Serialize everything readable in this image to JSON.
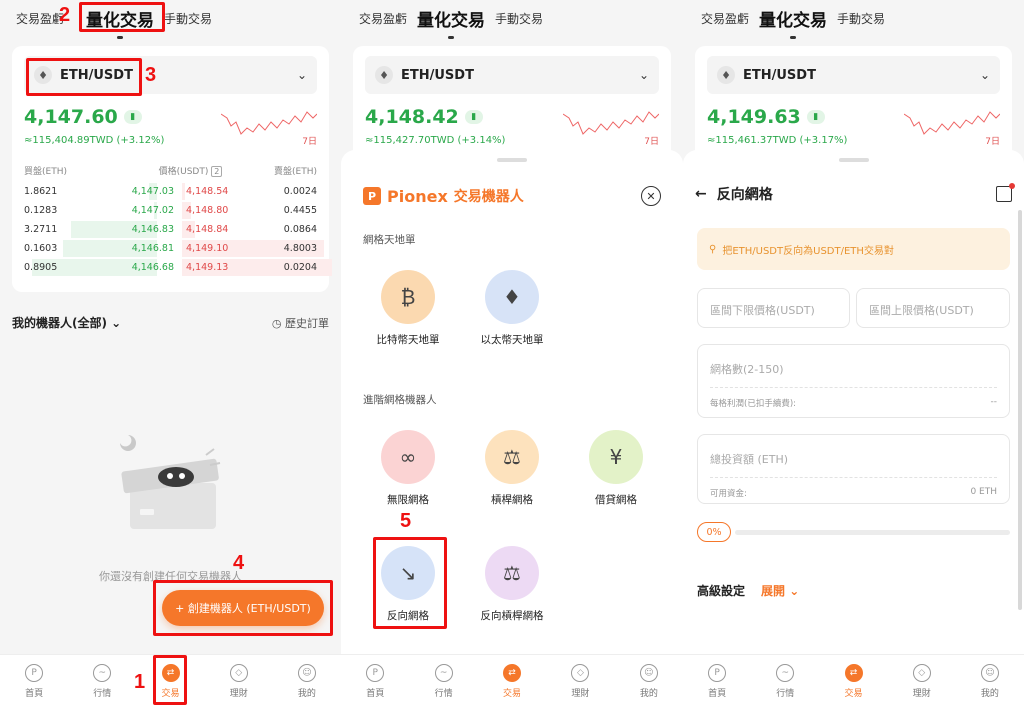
{
  "tabs": {
    "pnl": "交易盈虧",
    "quant": "量化交易",
    "manual": "手動交易"
  },
  "pair": "ETH/USDT",
  "screens": [
    {
      "price": "4,147.60",
      "twd": "≈115,404.89TWD (+3.12%)"
    },
    {
      "price": "4,148.42",
      "twd": "≈115,427.70TWD (+3.14%)"
    },
    {
      "price": "4,149.63",
      "twd": "≈115,461.37TWD (+3.17%)"
    }
  ],
  "spark_label": "7日",
  "orderbook": {
    "headers": {
      "bid_amount": "買盤(ETH)",
      "price": "價格(USDT)",
      "price_badge": "2",
      "ask_amount": "賣盤(ETH)"
    },
    "rows": [
      {
        "bid_amt": "1.8621",
        "bid": "4,147.03",
        "ask": "4,148.54",
        "ask_amt": "0.0024",
        "bid_fill": 0.05,
        "ask_fill": 0.02
      },
      {
        "bid_amt": "0.1283",
        "bid": "4,147.02",
        "ask": "4,148.80",
        "ask_amt": "0.4455",
        "bid_fill": 0.02,
        "ask_fill": 0.06
      },
      {
        "bid_amt": "3.2711",
        "bid": "4,146.83",
        "ask": "4,148.84",
        "ask_amt": "0.0864",
        "bid_fill": 0.55,
        "ask_fill": 0.08
      },
      {
        "bid_amt": "0.1603",
        "bid": "4,146.81",
        "ask": "4,149.10",
        "ask_amt": "4.8003",
        "bid_fill": 0.6,
        "ask_fill": 0.9
      },
      {
        "bid_amt": "0.8905",
        "bid": "4,146.68",
        "ask": "4,149.13",
        "ask_amt": "0.0204",
        "bid_fill": 0.8,
        "ask_fill": 0.95
      }
    ]
  },
  "robots": {
    "title": "我的機器人(全部)",
    "history": "歷史訂單",
    "empty": "你還沒有創建任何交易機器人",
    "create": "+ 創建機器人 (ETH/USDT)"
  },
  "nav": [
    {
      "label": "首頁",
      "icon": "home-icon",
      "glyph": "P"
    },
    {
      "label": "行情",
      "icon": "market-chart-icon",
      "glyph": "~"
    },
    {
      "label": "交易",
      "icon": "trade-icon",
      "glyph": "⇄"
    },
    {
      "label": "理財",
      "icon": "finance-diamond-icon",
      "glyph": "◇"
    },
    {
      "label": "我的",
      "icon": "profile-icon",
      "glyph": "☺"
    }
  ],
  "bot_sheet": {
    "brand": "Pionex",
    "brand_sub": "交易機器人",
    "section1": "網格天地單",
    "section2": "進階網格機器人",
    "bots1": [
      {
        "label": "比特幣天地單",
        "color": "#fbd9b0",
        "glyph": "₿"
      },
      {
        "label": "以太幣天地單",
        "color": "#d7e3f7",
        "glyph": "♦"
      }
    ],
    "bots2": [
      {
        "label": "無限網格",
        "color": "#fbd3d3",
        "glyph": "∞"
      },
      {
        "label": "槓桿網格",
        "color": "#fde2bd",
        "glyph": "⚖"
      },
      {
        "label": "借貸網格",
        "color": "#e3f2c8",
        "glyph": "¥"
      }
    ],
    "bots3": [
      {
        "label": "反向網格",
        "color": "#d6e3f8",
        "glyph": "↘"
      },
      {
        "label": "反向槓桿網格",
        "color": "#eddaf4",
        "glyph": "⚖"
      }
    ]
  },
  "reverse_form": {
    "title": "反向網格",
    "tip": "把ETH/USDT反向為USDT/ETH交易對",
    "lower": "區間下限價格(USDT)",
    "upper": "區間上限價格(USDT)",
    "grid": "網格數(2-150)",
    "profit_label": "每格利潤(已扣手續費):",
    "profit_value": "--",
    "invest": "總投資額 (ETH)",
    "avail_label": "可用資金:",
    "avail_value": "0 ETH",
    "pct": "0%",
    "advanced": "高級設定",
    "expand": "展開"
  },
  "annotations": [
    "1",
    "2",
    "3",
    "4",
    "5"
  ],
  "colors": {
    "accent": "#f5772a",
    "up": "#2aa84a",
    "down": "#e04848",
    "annotation": "#e11111"
  }
}
